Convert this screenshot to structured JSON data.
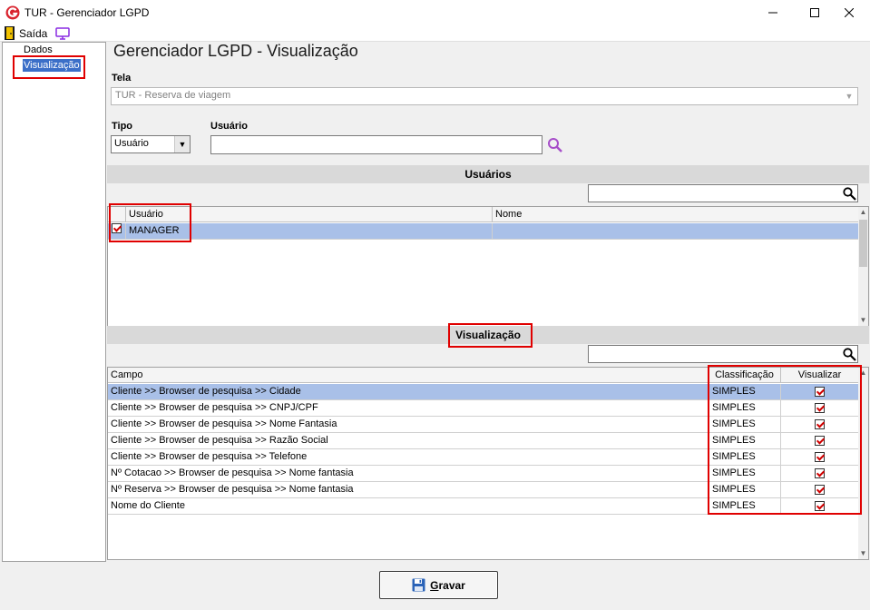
{
  "window": {
    "title": "TUR - Gerenciador LGPD"
  },
  "menu": {
    "exit_label": "Saída"
  },
  "tree": {
    "items": [
      "Dados",
      "Visualização"
    ]
  },
  "page": {
    "title": "Gerenciador LGPD - Visualização"
  },
  "filters": {
    "tela_label": "Tela",
    "tela_value": "TUR - Reserva de viagem",
    "tipo_label": "Tipo",
    "tipo_value": "Usuário",
    "usuario_label": "Usuário",
    "usuario_value": ""
  },
  "usuarios_section": {
    "header": "Usuários",
    "search_value": "",
    "columns": [
      "Usuário",
      "Nome"
    ],
    "rows": [
      {
        "checked": true,
        "usuario": "MANAGER",
        "nome": ""
      }
    ]
  },
  "visualizacao_section": {
    "header": "Visualização",
    "search_value": "",
    "columns": [
      "Campo",
      "Classificação",
      "Visualizar"
    ],
    "rows": [
      {
        "campo": "Cliente >> Browser de pesquisa >> Cidade",
        "classificacao": "SIMPLES",
        "visualizar": true
      },
      {
        "campo": "Cliente >> Browser de pesquisa >> CNPJ/CPF",
        "classificacao": "SIMPLES",
        "visualizar": true
      },
      {
        "campo": "Cliente >> Browser de pesquisa >> Nome Fantasia",
        "classificacao": "SIMPLES",
        "visualizar": true
      },
      {
        "campo": "Cliente >> Browser de pesquisa >> Razão Social",
        "classificacao": "SIMPLES",
        "visualizar": true
      },
      {
        "campo": "Cliente >> Browser de pesquisa >> Telefone",
        "classificacao": "SIMPLES",
        "visualizar": true
      },
      {
        "campo": "Nº Cotacao >> Browser de pesquisa >> Nome fantasia",
        "classificacao": "SIMPLES",
        "visualizar": true
      },
      {
        "campo": "Nº Reserva >> Browser de pesquisa >> Nome fantasia",
        "classificacao": "SIMPLES",
        "visualizar": true
      },
      {
        "campo": "Nome do Cliente",
        "classificacao": "SIMPLES",
        "visualizar": true
      }
    ]
  },
  "footer": {
    "gravar_first": "G",
    "gravar_rest": "ravar"
  },
  "colors": {
    "highlight_box": "#e00000",
    "selected_row": "#a9c0e8",
    "tree_selected": "#3b6fc8",
    "logo": "#d9232e"
  }
}
